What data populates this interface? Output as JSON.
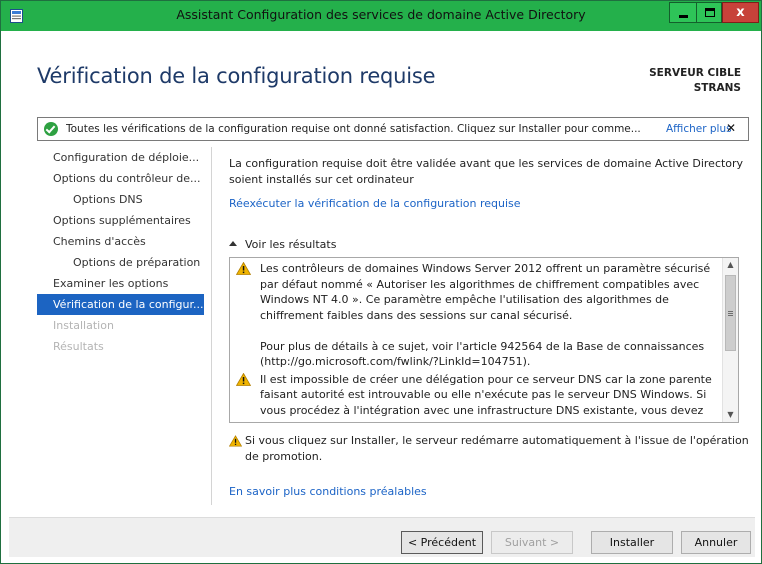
{
  "window": {
    "title": "Assistant Configuration des services de domaine Active Directory",
    "min_icon": "minimize-icon",
    "max_icon": "maximize-icon",
    "close_glyph": "x"
  },
  "header": {
    "page_title": "Vérification de la configuration requise",
    "target_label": "SERVEUR CIBLE",
    "target_name": "STRANS"
  },
  "notification": {
    "icon": "check-circle-icon",
    "text": "Toutes les vérifications de la configuration requise ont donné satisfaction. Cliquez sur Installer pour comme...",
    "more_link": "Afficher plus",
    "close_glyph": "✕"
  },
  "nav": {
    "items": [
      {
        "label": "Configuration de déploie...",
        "state": "normal"
      },
      {
        "label": "Options du contrôleur de...",
        "state": "normal"
      },
      {
        "label": "Options DNS",
        "state": "sub"
      },
      {
        "label": "Options supplémentaires",
        "state": "normal"
      },
      {
        "label": "Chemins d'accès",
        "state": "normal"
      },
      {
        "label": "Options de préparation",
        "state": "sub"
      },
      {
        "label": "Examiner les options",
        "state": "normal"
      },
      {
        "label": "Vérification de la configur...",
        "state": "active"
      },
      {
        "label": "Installation",
        "state": "disabled"
      },
      {
        "label": "Résultats",
        "state": "disabled"
      }
    ]
  },
  "main": {
    "intro": "La configuration requise doit être validée avant que les services de domaine Active Directory soient installés sur cet ordinateur",
    "rerun_link": "Réexécuter la vérification de la configuration requise",
    "results_toggle": "Voir les résultats",
    "results": {
      "msg1_para1": "Les contrôleurs de domaines Windows Server 2012 offrent un paramètre sécurisé par défaut nommé « Autoriser les algorithmes de chiffrement compatibles avec Windows NT 4.0 ». Ce paramètre empêche l'utilisation des algorithmes de chiffrement faibles dans des sessions sur canal sécurisé.",
      "msg1_para2": "Pour plus de détails à ce sujet, voir l'article 942564 de la Base de connaissances (http://go.microsoft.com/fwlink/?LinkId=104751).",
      "msg2": "Il est impossible de créer une délégation pour ce serveur DNS car la zone parente faisant autorité est introuvable ou elle n'exécute pas le serveur DNS Windows. Si vous procédez à l'intégration avec une infrastructure DNS existante, vous devez"
    },
    "restart_warning": "Si vous cliquez sur Installer, le serveur redémarre automatiquement à l'issue de l'opération de promotion.",
    "learn_more_link": "En savoir plus conditions préalables"
  },
  "footer": {
    "prev_label": "< Précédent",
    "next_label": "Suivant >",
    "install_label": "Installer",
    "cancel_label": "Annuler"
  },
  "colors": {
    "titlebar": "#24b04b",
    "accent_blue": "#1c64c2",
    "link": "#1b63c6",
    "page_title": "#1e3a68",
    "success": "#2ea142",
    "warning": "#f0b400"
  }
}
